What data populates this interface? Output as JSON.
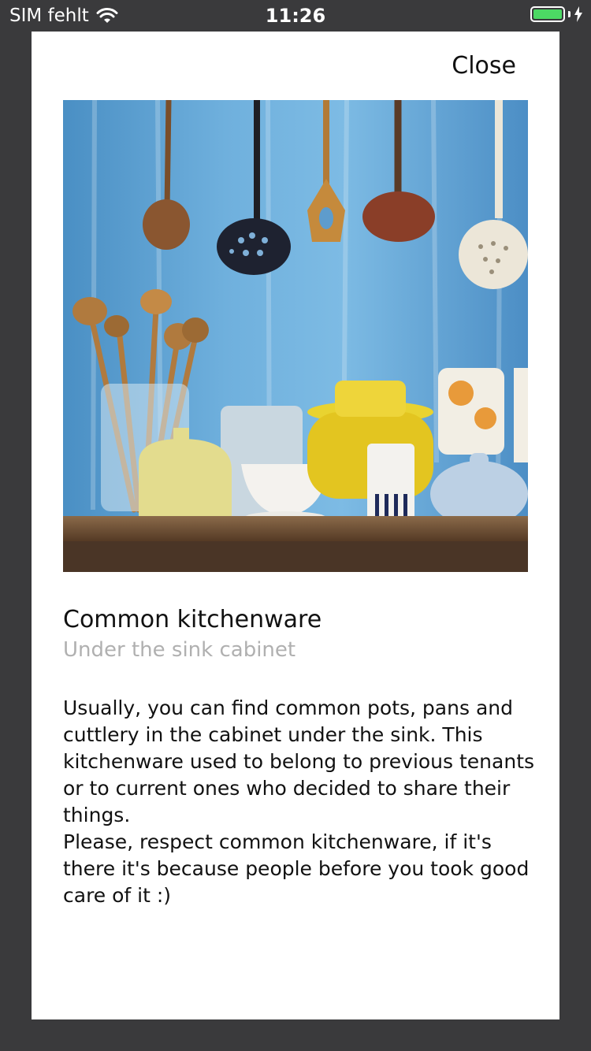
{
  "status_bar": {
    "carrier": "SIM fehlt",
    "time": "11:26",
    "battery_fill_fraction": 1.0,
    "battery_color": "#4cd964",
    "icons": [
      "wifi-icon",
      "battery-icon",
      "charging-bolt-icon"
    ]
  },
  "modal": {
    "close_label": "Close",
    "image": {
      "subject": "kitchen utensils hanging and ceramic pots on a wooden shelf against a blue wall"
    },
    "title": "Common kitchenware",
    "subtitle": "Under the sink cabinet",
    "body": [
      "Usually, you can find common pots, pans and cuttlery in the cabinet under the sink. This kitchenware used to belong to previous tenants or to current ones who decided to share their things.",
      "Please, respect common kitchenware, if it's there it's because people before you took good care of it :)"
    ]
  },
  "colors": {
    "backdrop": "#3a3a3c",
    "card": "#ffffff",
    "subtitle": "#b0b0b0"
  }
}
